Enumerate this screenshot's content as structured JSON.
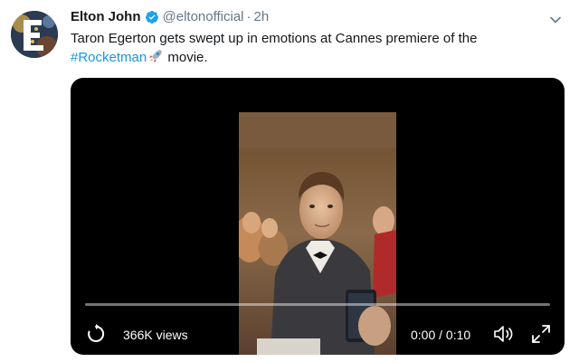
{
  "tweet": {
    "author_name": "Elton John",
    "handle": "@eltonofficial",
    "separator": "·",
    "time": "2h",
    "text_before": "Taron Egerton gets swept up in emotions at Cannes premiere of the",
    "hashtag": "#Rocketman",
    "text_after": "movie."
  },
  "video": {
    "views": "366K views",
    "timestamp": "0:00 / 0:10",
    "progress": 0
  },
  "icons": {
    "verified": "verified-badge-icon",
    "caret": "chevron-down-icon",
    "rocket": "rocket-emoji-icon",
    "replay": "replay-icon",
    "volume": "volume-icon",
    "fullscreen": "fullscreen-icon"
  },
  "colors": {
    "link": "#1b95e0",
    "secondary_text": "#657786",
    "video_bg": "#000000"
  }
}
